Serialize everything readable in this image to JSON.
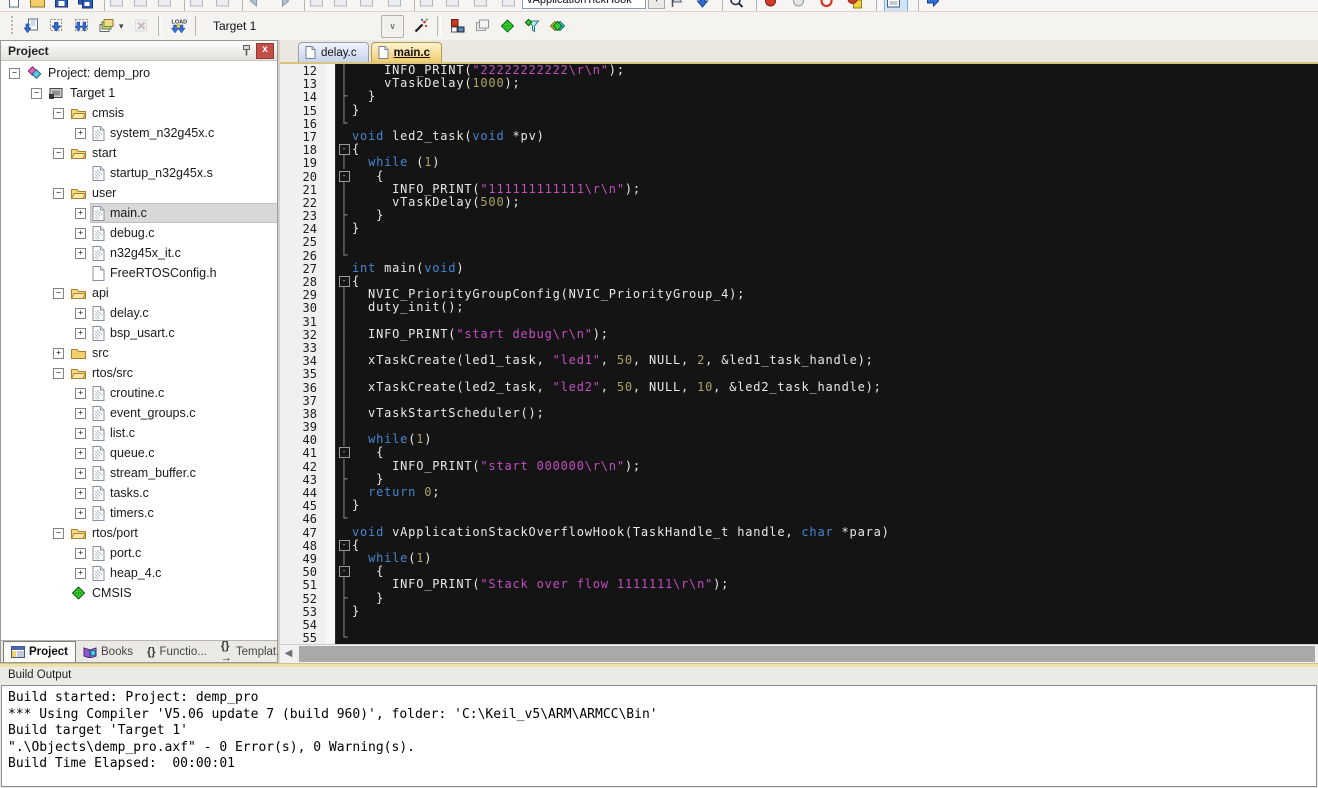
{
  "toolbar_top": {
    "symbol_value": "vApplicationTickHook",
    "items": [
      {
        "t": "i",
        "n": "doc-new-icon"
      },
      {
        "t": "i",
        "n": "open-icon"
      },
      {
        "t": "i",
        "n": "save-icon"
      },
      {
        "t": "i",
        "n": "save-all-icon"
      },
      {
        "t": "sep"
      },
      {
        "t": "i",
        "n": "cut-icon"
      },
      {
        "t": "i",
        "n": "copy-icon"
      },
      {
        "t": "i",
        "n": "paste-icon"
      },
      {
        "t": "sep"
      },
      {
        "t": "i",
        "n": "undo-icon"
      },
      {
        "t": "i",
        "n": "redo-icon"
      },
      {
        "t": "sep"
      },
      {
        "t": "i",
        "n": "nav-back-icon"
      },
      {
        "t": "i",
        "n": "nav-forward-icon"
      },
      {
        "t": "sep"
      },
      {
        "t": "i",
        "n": "bookmark-icon"
      },
      {
        "t": "i",
        "n": "bookmark-prev-icon"
      },
      {
        "t": "i",
        "n": "bookmark-next-icon"
      },
      {
        "t": "i",
        "n": "bookmark-clear-icon"
      },
      {
        "t": "sep"
      },
      {
        "t": "i",
        "n": "indent-icon"
      },
      {
        "t": "i",
        "n": "outdent-icon"
      },
      {
        "t": "i",
        "n": "comment-icon"
      },
      {
        "t": "i",
        "n": "uncomment-icon"
      },
      {
        "t": "combo"
      },
      {
        "t": "combo-arrow"
      },
      {
        "t": "i",
        "n": "symbol-flag-icon"
      },
      {
        "t": "i",
        "n": "down-arrow-icon"
      },
      {
        "t": "sep"
      },
      {
        "t": "i",
        "n": "find-icon"
      },
      {
        "t": "sep"
      },
      {
        "t": "i",
        "n": "breakpoint-icon"
      },
      {
        "t": "i",
        "n": "breakpoint-disable-icon"
      },
      {
        "t": "i",
        "n": "breakpoint-kill-icon"
      },
      {
        "t": "i",
        "n": "breakpoint-killall-icon"
      },
      {
        "t": "sep"
      },
      {
        "t": "hl",
        "n": "memory-window-icon"
      },
      {
        "t": "sep"
      },
      {
        "t": "i",
        "n": "forward-arrow-icon"
      }
    ]
  },
  "toolbar_main": {
    "target_value": "Target 1",
    "items": [
      {
        "t": "i",
        "n": "translate-icon"
      },
      {
        "t": "i",
        "n": "build-icon"
      },
      {
        "t": "i",
        "n": "rebuild-icon"
      },
      {
        "t": "i",
        "n": "batch-build-icon"
      },
      {
        "t": "caret"
      },
      {
        "t": "i",
        "n": "stop-build-icon",
        "disabled": true
      },
      {
        "t": "sep"
      },
      {
        "t": "i",
        "n": "download-icon"
      },
      {
        "t": "sep"
      },
      {
        "t": "combo"
      },
      {
        "t": "combo-btn"
      },
      {
        "t": "i",
        "n": "target-options-icon"
      },
      {
        "t": "sep"
      },
      {
        "t": "i",
        "n": "manage-items-icon"
      },
      {
        "t": "i",
        "n": "manage-books-icon"
      },
      {
        "t": "i",
        "n": "rte-icon"
      },
      {
        "t": "i",
        "n": "select-packs-icon"
      },
      {
        "t": "i",
        "n": "pack-installer-icon"
      }
    ]
  },
  "project_panel": {
    "title": "Project",
    "tabs": [
      {
        "label": "Project",
        "icon": "project-tab-icon",
        "active": true
      },
      {
        "label": "Books",
        "icon": "books-icon",
        "active": false
      },
      {
        "label": "Functio...",
        "icon": "functions-icon",
        "active": false
      },
      {
        "label": "Templat...",
        "icon": "templates-icon",
        "active": false
      }
    ],
    "tree": [
      {
        "label": "Project: demp_pro",
        "level": 0,
        "exp": "minus",
        "icon": "project-icon"
      },
      {
        "label": "Target 1",
        "level": 1,
        "exp": "minus",
        "icon": "target-icon"
      },
      {
        "label": "cmsis",
        "level": 2,
        "exp": "minus",
        "icon": "folder-icon"
      },
      {
        "label": "system_n32g45x.c",
        "level": 3,
        "exp": "plus",
        "icon": "file-c-icon"
      },
      {
        "label": "start",
        "level": 2,
        "exp": "minus",
        "icon": "folder-icon"
      },
      {
        "label": "startup_n32g45x.s",
        "level": 3,
        "exp": "none",
        "icon": "file-c-icon"
      },
      {
        "label": "user",
        "level": 2,
        "exp": "minus",
        "icon": "folder-icon"
      },
      {
        "label": "main.c",
        "level": 3,
        "exp": "plus",
        "icon": "file-c-icon",
        "selected": true
      },
      {
        "label": "debug.c",
        "level": 3,
        "exp": "plus",
        "icon": "file-c-icon"
      },
      {
        "label": "n32g45x_it.c",
        "level": 3,
        "exp": "plus",
        "icon": "file-c-icon"
      },
      {
        "label": "FreeRTOSConfig.h",
        "level": 3,
        "exp": "none",
        "icon": "file-plain-icon"
      },
      {
        "label": "api",
        "level": 2,
        "exp": "minus",
        "icon": "folder-icon"
      },
      {
        "label": "delay.c",
        "level": 3,
        "exp": "plus",
        "icon": "file-c-icon"
      },
      {
        "label": "bsp_usart.c",
        "level": 3,
        "exp": "plus",
        "icon": "file-c-icon"
      },
      {
        "label": "src",
        "level": 2,
        "exp": "plus",
        "icon": "folder-closed-icon"
      },
      {
        "label": "rtos/src",
        "level": 2,
        "exp": "minus",
        "icon": "folder-icon"
      },
      {
        "label": "croutine.c",
        "level": 3,
        "exp": "plus",
        "icon": "file-c-icon"
      },
      {
        "label": "event_groups.c",
        "level": 3,
        "exp": "plus",
        "icon": "file-c-icon"
      },
      {
        "label": "list.c",
        "level": 3,
        "exp": "plus",
        "icon": "file-c-icon"
      },
      {
        "label": "queue.c",
        "level": 3,
        "exp": "plus",
        "icon": "file-c-icon"
      },
      {
        "label": "stream_buffer.c",
        "level": 3,
        "exp": "plus",
        "icon": "file-c-icon"
      },
      {
        "label": "tasks.c",
        "level": 3,
        "exp": "plus",
        "icon": "file-c-icon"
      },
      {
        "label": "timers.c",
        "level": 3,
        "exp": "plus",
        "icon": "file-c-icon"
      },
      {
        "label": "rtos/port",
        "level": 2,
        "exp": "minus",
        "icon": "folder-icon"
      },
      {
        "label": "port.c",
        "level": 3,
        "exp": "plus",
        "icon": "file-c-icon"
      },
      {
        "label": "heap_4.c",
        "level": 3,
        "exp": "plus",
        "icon": "file-c-icon"
      },
      {
        "label": "CMSIS",
        "level": 2,
        "exp": "none",
        "icon": "cmsis-icon"
      }
    ]
  },
  "editor": {
    "tabs": [
      {
        "label": "delay.c",
        "active": false
      },
      {
        "label": "main.c",
        "active": true
      }
    ],
    "code": {
      "lines": [
        {
          "n": 12,
          "f": "v",
          "s": [
            [
              "d",
              "    INFO_PRINT("
            ],
            [
              "s",
              "\"22222222222\\r\\n\""
            ],
            [
              "d",
              ");"
            ]
          ]
        },
        {
          "n": 13,
          "f": "v",
          "s": [
            [
              "d",
              "    vTaskDelay("
            ],
            [
              "n",
              "1000"
            ],
            [
              "d",
              ");"
            ]
          ]
        },
        {
          "n": 14,
          "f": "b",
          "s": [
            [
              "d",
              "  }"
            ]
          ]
        },
        {
          "n": 15,
          "f": "v",
          "s": [
            [
              "d",
              "}"
            ]
          ]
        },
        {
          "n": 16,
          "f": "e",
          "s": []
        },
        {
          "n": 17,
          "f": "",
          "s": [
            [
              "k",
              "void"
            ],
            [
              "d",
              " led2_task("
            ],
            [
              "k",
              "void"
            ],
            [
              "d",
              " *pv)"
            ]
          ]
        },
        {
          "n": 18,
          "f": "m",
          "s": [
            [
              "d",
              "{"
            ]
          ]
        },
        {
          "n": 19,
          "f": "v",
          "s": [
            [
              "d",
              "  "
            ],
            [
              "k",
              "while"
            ],
            [
              "d",
              " ("
            ],
            [
              "n",
              "1"
            ],
            [
              "d",
              ")"
            ]
          ]
        },
        {
          "n": 20,
          "f": "m",
          "s": [
            [
              "d",
              "   {"
            ]
          ]
        },
        {
          "n": 21,
          "f": "v",
          "s": [
            [
              "d",
              "     INFO_PRINT("
            ],
            [
              "s",
              "\"111111111111\\r\\n\""
            ],
            [
              "d",
              ");"
            ]
          ]
        },
        {
          "n": 22,
          "f": "v",
          "s": [
            [
              "d",
              "     vTaskDelay("
            ],
            [
              "n",
              "500"
            ],
            [
              "d",
              ");"
            ]
          ]
        },
        {
          "n": 23,
          "f": "b",
          "s": [
            [
              "d",
              "   }"
            ]
          ]
        },
        {
          "n": 24,
          "f": "v",
          "s": [
            [
              "d",
              "}"
            ]
          ]
        },
        {
          "n": 25,
          "f": "v",
          "s": []
        },
        {
          "n": 26,
          "f": "e",
          "s": []
        },
        {
          "n": 27,
          "f": "",
          "s": [
            [
              "k",
              "int"
            ],
            [
              "d",
              " main("
            ],
            [
              "k",
              "void"
            ],
            [
              "d",
              ")"
            ]
          ]
        },
        {
          "n": 28,
          "f": "m",
          "s": [
            [
              "d",
              "{"
            ]
          ]
        },
        {
          "n": 29,
          "f": "v",
          "s": [
            [
              "d",
              "  NVIC_PriorityGroupConfig(NVIC_PriorityGroup_4);"
            ]
          ]
        },
        {
          "n": 30,
          "f": "v",
          "s": [
            [
              "d",
              "  duty_init();"
            ]
          ]
        },
        {
          "n": 31,
          "f": "v",
          "s": []
        },
        {
          "n": 32,
          "f": "v",
          "s": [
            [
              "d",
              "  INFO_PRINT("
            ],
            [
              "s",
              "\"start debug\\r\\n\""
            ],
            [
              "d",
              ");"
            ]
          ]
        },
        {
          "n": 33,
          "f": "v",
          "s": []
        },
        {
          "n": 34,
          "f": "v",
          "s": [
            [
              "d",
              "  xTaskCreate(led1_task, "
            ],
            [
              "s",
              "\"led1\""
            ],
            [
              "d",
              ", "
            ],
            [
              "n",
              "50"
            ],
            [
              "d",
              ", NULL, "
            ],
            [
              "n",
              "2"
            ],
            [
              "d",
              ", &led1_task_handle);"
            ]
          ]
        },
        {
          "n": 35,
          "f": "v",
          "s": []
        },
        {
          "n": 36,
          "f": "v",
          "s": [
            [
              "d",
              "  xTaskCreate(led2_task, "
            ],
            [
              "s",
              "\"led2\""
            ],
            [
              "d",
              ", "
            ],
            [
              "n",
              "50"
            ],
            [
              "d",
              ", NULL, "
            ],
            [
              "n",
              "10"
            ],
            [
              "d",
              ", &led2_task_handle);"
            ]
          ]
        },
        {
          "n": 37,
          "f": "v",
          "s": []
        },
        {
          "n": 38,
          "f": "v",
          "s": [
            [
              "d",
              "  vTaskStartScheduler();"
            ]
          ]
        },
        {
          "n": 39,
          "f": "v",
          "s": []
        },
        {
          "n": 40,
          "f": "v",
          "s": [
            [
              "d",
              "  "
            ],
            [
              "k",
              "while"
            ],
            [
              "d",
              "("
            ],
            [
              "n",
              "1"
            ],
            [
              "d",
              ")"
            ]
          ]
        },
        {
          "n": 41,
          "f": "m",
          "s": [
            [
              "d",
              "   {"
            ]
          ]
        },
        {
          "n": 42,
          "f": "v",
          "s": [
            [
              "d",
              "     INFO_PRINT("
            ],
            [
              "s",
              "\"start 000000\\r\\n\""
            ],
            [
              "d",
              ");"
            ]
          ]
        },
        {
          "n": 43,
          "f": "b",
          "s": [
            [
              "d",
              "   }"
            ]
          ]
        },
        {
          "n": 44,
          "f": "v",
          "s": [
            [
              "d",
              "  "
            ],
            [
              "k",
              "return"
            ],
            [
              "d",
              " "
            ],
            [
              "n",
              "0"
            ],
            [
              "d",
              ";"
            ]
          ]
        },
        {
          "n": 45,
          "f": "v",
          "s": [
            [
              "d",
              "}"
            ]
          ]
        },
        {
          "n": 46,
          "f": "e",
          "s": []
        },
        {
          "n": 47,
          "f": "",
          "s": [
            [
              "k",
              "void"
            ],
            [
              "d",
              " vApplicationStackOverflowHook(TaskHandle_t handle, "
            ],
            [
              "k",
              "char"
            ],
            [
              "d",
              " *para)"
            ]
          ]
        },
        {
          "n": 48,
          "f": "m",
          "s": [
            [
              "d",
              "{"
            ]
          ]
        },
        {
          "n": 49,
          "f": "v",
          "s": [
            [
              "d",
              "  "
            ],
            [
              "k",
              "while"
            ],
            [
              "d",
              "("
            ],
            [
              "n",
              "1"
            ],
            [
              "d",
              ")"
            ]
          ]
        },
        {
          "n": 50,
          "f": "m",
          "s": [
            [
              "d",
              "   {"
            ]
          ]
        },
        {
          "n": 51,
          "f": "v",
          "s": [
            [
              "d",
              "     INFO_PRINT("
            ],
            [
              "s",
              "\"Stack over flow 1111111\\r\\n\""
            ],
            [
              "d",
              ");"
            ]
          ]
        },
        {
          "n": 52,
          "f": "b",
          "s": [
            [
              "d",
              "   }"
            ]
          ]
        },
        {
          "n": 53,
          "f": "v",
          "s": [
            [
              "d",
              "}"
            ]
          ]
        },
        {
          "n": 54,
          "f": "v",
          "s": []
        },
        {
          "n": 55,
          "f": "e",
          "s": []
        }
      ]
    }
  },
  "build_output": {
    "title": "Build Output",
    "lines": [
      "Build started: Project: demp_pro",
      "*** Using Compiler 'V5.06 update 7 (build 960)', folder: 'C:\\Keil_v5\\ARM\\ARMCC\\Bin'",
      "Build target 'Target 1'",
      "\".\\Objects\\demp_pro.axf\" - 0 Error(s), 0 Warning(s).",
      "Build Time Elapsed:  00:00:01"
    ]
  },
  "colors": {
    "editor_bg": "#141414",
    "keyword": "#4585d0",
    "string": "#c04ec0",
    "number": "#a9a265",
    "active_tab": "#f1cb6e",
    "close_button": "#c25048"
  }
}
